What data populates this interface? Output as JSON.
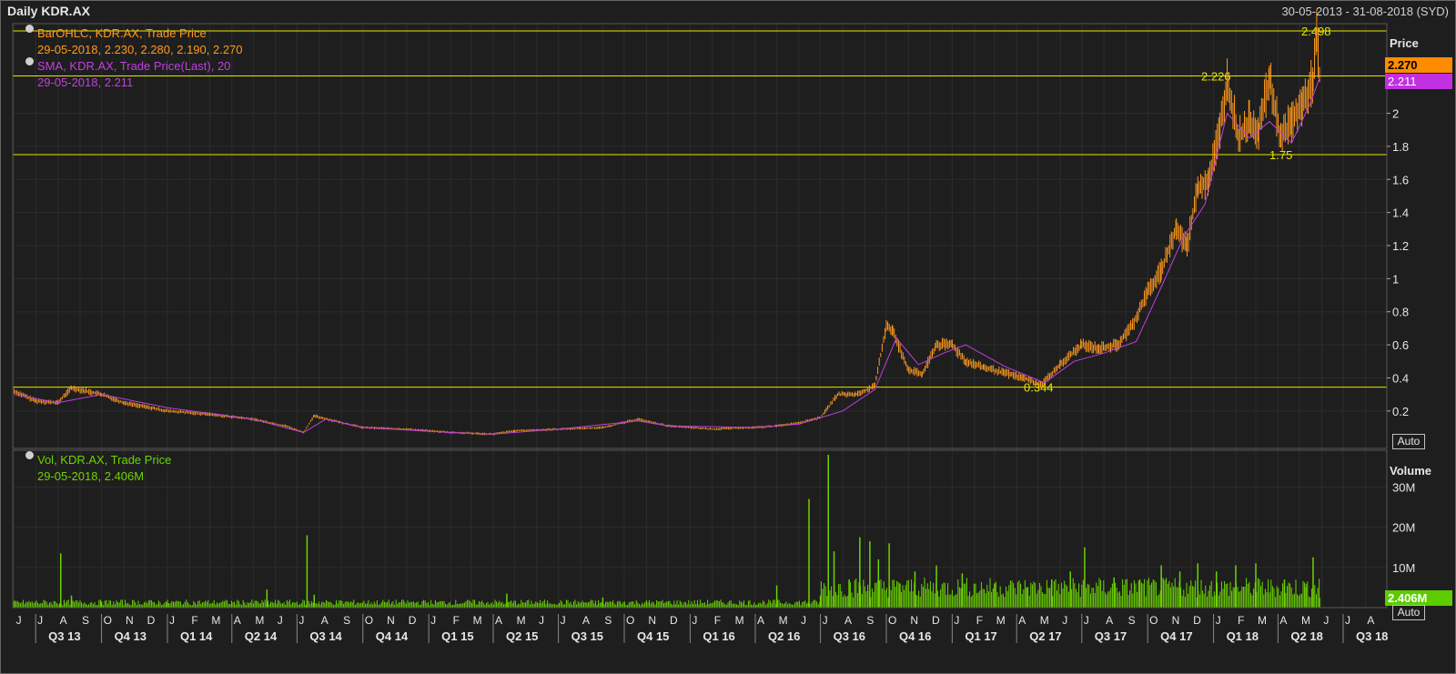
{
  "header": {
    "title": "Daily KDR.AX",
    "range": "30-05-2013 - 31-08-2018 (SYD)"
  },
  "legend": {
    "ohlc_name": "BarOHLC, KDR.AX, Trade Price",
    "ohlc_values": "29-05-2018, 2.230, 2.280, 2.190, 2.270",
    "sma_name": "SMA, KDR.AX, Trade Price(Last),  20",
    "sma_values": "29-05-2018, 2.211",
    "vol_name": "Vol, KDR.AX, Trade Price",
    "vol_values": "29-05-2018, 2.406M"
  },
  "price_axis": {
    "title": "Price",
    "last_price": "2.270",
    "last_sma": "2.211",
    "auto": "Auto"
  },
  "volume_axis": {
    "title": "Volume",
    "last_volume": "2.406M",
    "auto": "Auto"
  },
  "colors": {
    "background": "#1e1e1e",
    "price_bars": "#ff9a1f",
    "sma": "#c040e0",
    "volume": "#6cd400",
    "levels": "#e6e600",
    "grid": "#2c2c2c"
  },
  "chart_data": [
    {
      "type": "line",
      "subtype": "ohlc",
      "title": "Daily KDR.AX",
      "ylabel": "Price",
      "ylim": [
        0.1,
        2.52
      ],
      "y_ticks": [
        0.2,
        0.4,
        0.6,
        0.8,
        1,
        1.2,
        1.4,
        1.6,
        1.8,
        2
      ],
      "x_range": [
        "2013-05-30",
        "2018-08-31"
      ],
      "grid": true,
      "legend_position": "top-left",
      "horizontal_levels": [
        {
          "value": 2.498,
          "label": "2.498"
        },
        {
          "value": 2.226,
          "label": "2.226"
        },
        {
          "value": 1.75,
          "label": "1.75"
        },
        {
          "value": 0.344,
          "label": "0.344"
        }
      ],
      "series": [
        {
          "name": "BarOHLC, KDR.AX, Trade Price",
          "color": "#ff9a1f",
          "x": [
            "2013-06-01",
            "2013-07-01",
            "2013-08-01",
            "2013-08-20",
            "2013-10-01",
            "2013-11-01",
            "2014-01-01",
            "2014-03-01",
            "2014-05-01",
            "2014-06-15",
            "2014-07-10",
            "2014-07-25",
            "2014-09-01",
            "2014-10-01",
            "2014-12-01",
            "2015-02-01",
            "2015-04-01",
            "2015-05-01",
            "2015-07-01",
            "2015-09-01",
            "2015-10-20",
            "2015-12-01",
            "2016-02-01",
            "2016-04-01",
            "2016-05-01",
            "2016-06-01",
            "2016-07-01",
            "2016-07-25",
            "2016-08-20",
            "2016-09-15",
            "2016-10-01",
            "2016-10-10",
            "2016-11-01",
            "2016-11-20",
            "2016-12-10",
            "2017-01-01",
            "2017-01-20",
            "2017-02-15",
            "2017-03-15",
            "2017-04-10",
            "2017-05-05",
            "2017-06-01",
            "2017-07-01",
            "2017-07-25",
            "2017-08-20",
            "2017-09-10",
            "2017-10-01",
            "2017-10-20",
            "2017-11-10",
            "2017-11-25",
            "2017-12-10",
            "2017-12-25",
            "2018-01-10",
            "2018-01-20",
            "2018-02-05",
            "2018-02-20",
            "2018-03-05",
            "2018-03-20",
            "2018-04-05",
            "2018-04-20",
            "2018-05-05",
            "2018-05-20",
            "2018-05-25",
            "2018-05-29"
          ],
          "values": [
            0.32,
            0.26,
            0.25,
            0.34,
            0.3,
            0.25,
            0.2,
            0.18,
            0.15,
            0.11,
            0.07,
            0.17,
            0.13,
            0.1,
            0.09,
            0.07,
            0.06,
            0.08,
            0.09,
            0.1,
            0.15,
            0.11,
            0.09,
            0.1,
            0.11,
            0.13,
            0.16,
            0.3,
            0.3,
            0.35,
            0.72,
            0.68,
            0.45,
            0.42,
            0.6,
            0.6,
            0.5,
            0.46,
            0.43,
            0.4,
            0.36,
            0.48,
            0.6,
            0.58,
            0.6,
            0.72,
            0.92,
            1.05,
            1.3,
            1.2,
            1.55,
            1.6,
            1.9,
            2.2,
            1.85,
            1.95,
            1.9,
            2.2,
            1.85,
            1.95,
            2.05,
            2.2,
            2.49,
            2.27
          ]
        },
        {
          "name": "SMA, KDR.AX, Trade Price(Last),  20",
          "color": "#c040e0",
          "x": [
            "2013-06-01",
            "2013-08-01",
            "2013-10-01",
            "2014-01-01",
            "2014-05-01",
            "2014-07-10",
            "2014-08-10",
            "2014-10-01",
            "2015-02-01",
            "2015-04-01",
            "2015-07-01",
            "2015-10-20",
            "2015-12-01",
            "2016-04-01",
            "2016-06-01",
            "2016-08-01",
            "2016-09-15",
            "2016-10-15",
            "2016-11-15",
            "2016-12-20",
            "2017-01-20",
            "2017-03-15",
            "2017-05-10",
            "2017-06-20",
            "2017-08-01",
            "2017-09-15",
            "2017-10-20",
            "2017-11-20",
            "2017-12-20",
            "2018-01-20",
            "2018-02-20",
            "2018-03-20",
            "2018-04-20",
            "2018-05-15",
            "2018-05-29"
          ],
          "values": [
            0.3,
            0.25,
            0.3,
            0.22,
            0.15,
            0.07,
            0.15,
            0.1,
            0.07,
            0.06,
            0.09,
            0.14,
            0.11,
            0.1,
            0.12,
            0.2,
            0.33,
            0.64,
            0.48,
            0.55,
            0.6,
            0.47,
            0.37,
            0.5,
            0.55,
            0.62,
            0.95,
            1.25,
            1.45,
            2.0,
            1.85,
            1.95,
            1.82,
            2.05,
            2.211
          ]
        }
      ]
    },
    {
      "type": "bar",
      "title": "Vol, KDR.AX, Trade Price",
      "ylabel": "Volume",
      "y_ticks": [
        "10M",
        "20M",
        "30M"
      ],
      "ylim": [
        0,
        38
      ],
      "units": "M",
      "series": [
        {
          "name": "Vol, KDR.AX, Trade Price",
          "color": "#6cd400",
          "x": [
            "2013-06-01",
            "2013-08-05",
            "2013-08-20",
            "2013-10-01",
            "2014-01-01",
            "2014-05-20",
            "2014-07-15",
            "2014-07-25",
            "2015-04-20",
            "2015-09-01",
            "2016-05-01",
            "2016-06-15",
            "2016-07-01",
            "2016-07-12",
            "2016-07-20",
            "2016-08-10",
            "2016-08-25",
            "2016-09-08",
            "2016-09-20",
            "2016-10-05",
            "2016-10-20",
            "2016-11-10",
            "2016-12-10",
            "2017-01-15",
            "2017-03-01",
            "2017-04-15",
            "2017-05-20",
            "2017-06-15",
            "2017-07-05",
            "2017-08-15",
            "2017-09-20",
            "2017-10-20",
            "2017-11-15",
            "2017-12-10",
            "2018-01-05",
            "2018-02-01",
            "2018-03-01",
            "2018-04-10",
            "2018-05-10",
            "2018-05-20",
            "2018-05-29"
          ],
          "values": [
            1.5,
            13.5,
            3,
            1.5,
            1.2,
            4.5,
            18,
            3.2,
            3.5,
            2.5,
            5.5,
            27,
            3,
            38,
            14,
            7,
            17.5,
            16.5,
            12,
            16,
            6,
            9,
            10.5,
            8.5,
            6,
            5,
            7,
            9,
            15,
            7.5,
            7,
            10.5,
            9,
            11,
            9,
            10.5,
            11,
            7,
            5,
            12.5,
            2.406
          ]
        }
      ]
    }
  ],
  "x_axis": {
    "months": [
      "J",
      "J",
      "A",
      "S",
      "O",
      "N",
      "D",
      "J",
      "F",
      "M",
      "A",
      "M",
      "J",
      "J",
      "A",
      "S",
      "O",
      "N",
      "D",
      "J",
      "F",
      "M",
      "A",
      "M",
      "J",
      "J",
      "A",
      "S",
      "O",
      "N",
      "D",
      "J",
      "F",
      "M",
      "A",
      "M",
      "J",
      "J",
      "A",
      "S",
      "O",
      "N",
      "D",
      "J",
      "F",
      "M",
      "A",
      "M",
      "J",
      "J",
      "A",
      "S",
      "O",
      "N",
      "D",
      "J",
      "F",
      "M",
      "A",
      "M",
      "J",
      "J",
      "A"
    ],
    "quarters": [
      "Q3 13",
      "Q4 13",
      "Q1 14",
      "Q2 14",
      "Q3 14",
      "Q4 14",
      "Q1 15",
      "Q2 15",
      "Q3 15",
      "Q4 15",
      "Q1 16",
      "Q2 16",
      "Q3 16",
      "Q4 16",
      "Q1 17",
      "Q2 17",
      "Q3 17",
      "Q4 17",
      "Q1 18",
      "Q2 18",
      "Q3 18"
    ]
  }
}
